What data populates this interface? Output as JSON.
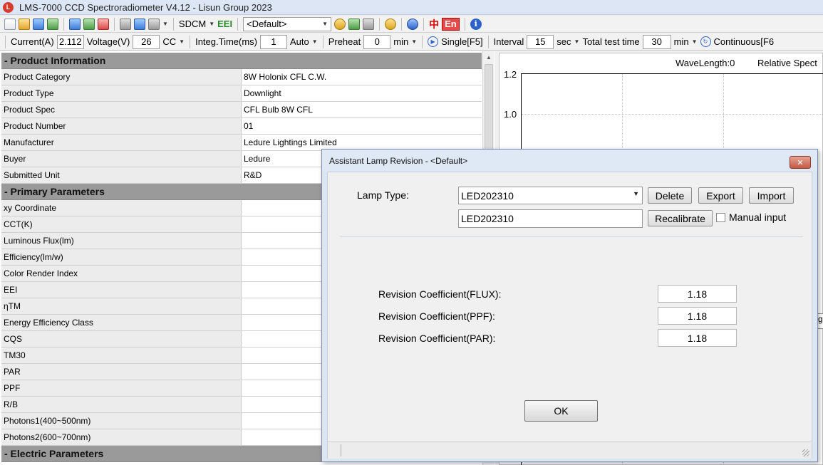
{
  "window": {
    "title": "LMS-7000 CCD Spectroradiometer V4.12 - Lisun Group 2023",
    "app_icon": "lisun-logo-icon"
  },
  "toolbar1": {
    "sdcm_label": "SDCM",
    "eei_label": "EEI",
    "profile_value": "<Default>",
    "lang_zh": "中",
    "lang_en": "En",
    "info_glyph": "i"
  },
  "toolbar2": {
    "current_label": "Current(A)",
    "current_value": "2.112",
    "voltage_label": "Voltage(V)",
    "voltage_value": "26",
    "mode_value": "CC",
    "integ_label": "Integ.Time(ms)",
    "integ_value": "1",
    "auto_value": "Auto",
    "preheat_label": "Preheat",
    "preheat_value": "0",
    "preheat_unit": "min",
    "single_label": "Single[F5]",
    "interval_label": "Interval",
    "interval_value": "15",
    "interval_unit": "sec",
    "total_label": "Total test time",
    "total_value": "30",
    "total_unit": "min",
    "continuous_label": "Continuous[F6"
  },
  "product_info": {
    "section_title": "- Product Information",
    "rows": [
      {
        "label": "Product Category",
        "value": "8W Holonix CFL C.W."
      },
      {
        "label": "Product Type",
        "value": "Downlight"
      },
      {
        "label": "Product Spec",
        "value": "CFL Bulb  8W CFL"
      },
      {
        "label": "Product Number",
        "value": "01"
      },
      {
        "label": "Manufacturer",
        "value": "Ledure Lightings Limited"
      },
      {
        "label": "Buyer",
        "value": "Ledure"
      },
      {
        "label": "Submitted Unit",
        "value": "R&D"
      }
    ]
  },
  "primary_params": {
    "section_title": "- Primary Parameters",
    "rows": [
      {
        "label": "xy Coordinate",
        "value": ""
      },
      {
        "label": "CCT(K)",
        "value": ""
      },
      {
        "label": "Luminous Flux(lm)",
        "value": ""
      },
      {
        "label": "Efficiency(lm/w)",
        "value": ""
      },
      {
        "label": "Color Render Index",
        "value": ""
      },
      {
        "label": "EEI",
        "value": ""
      },
      {
        "label": "ηTM",
        "value": ""
      },
      {
        "label": "Energy Efficiency Class",
        "value": ""
      },
      {
        "label": "CQS",
        "value": ""
      },
      {
        "label": "TM30",
        "value": ""
      },
      {
        "label": "PAR",
        "value": ""
      },
      {
        "label": "PPF",
        "value": ""
      },
      {
        "label": "R/B",
        "value": ""
      },
      {
        "label": "Photons1(400~500nm)",
        "value": ""
      },
      {
        "label": "Photons2(600~700nm)",
        "value": ""
      }
    ]
  },
  "electric_params": {
    "section_title": "- Electric Parameters"
  },
  "chart": {
    "wavelength_text": "WaveLength:0",
    "relative_text": "Relative Spect",
    "y_ticks": [
      "1.2",
      "1.0"
    ]
  },
  "dialog": {
    "title": "Assistant Lamp Revision - <Default>",
    "close_glyph": "✕",
    "lamp_type_label": "Lamp Type:",
    "lamp_type_value": "LED202310",
    "lamp_name_value": "LED202310",
    "delete_label": "Delete",
    "export_label": "Export",
    "import_label": "Import",
    "recalibrate_label": "Recalibrate",
    "manual_input_label": "Manual input",
    "manual_input_checked": false,
    "coefficients": [
      {
        "label": "Revision Coefficient(FLUX):",
        "value": "1.18"
      },
      {
        "label": "Revision Coefficient(PPF):",
        "value": "1.18"
      },
      {
        "label": "Revision Coefficient(PAR):",
        "value": "1.18"
      }
    ],
    "ok_label": "OK"
  },
  "partial_edge_text": "g"
}
